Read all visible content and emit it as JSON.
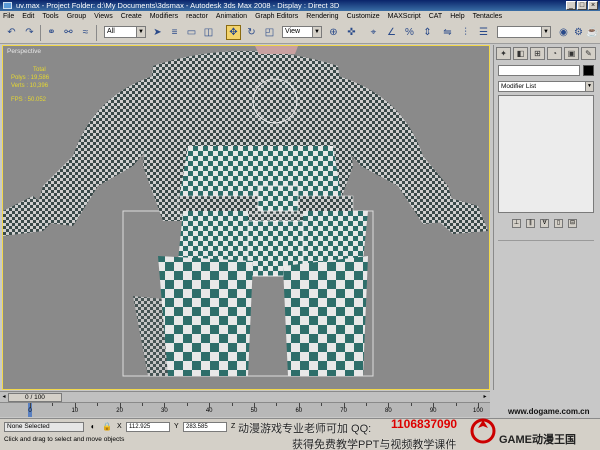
{
  "window": {
    "title": "uv.max    - Project Folder: d:\\My Documents\\3dsmax    - Autodesk 3ds Max 2008    - Display : Direct 3D",
    "controls": [
      "_",
      "□",
      "×"
    ]
  },
  "menu": [
    "File",
    "Edit",
    "Tools",
    "Group",
    "Views",
    "Create",
    "Modifiers",
    "reactor",
    "Animation",
    "Graph Editors",
    "Rendering",
    "Customize",
    "MAXScript",
    "CAT",
    "Help",
    "Tentacles"
  ],
  "toolbar": {
    "selection_filter": "All",
    "reference_coord": "View",
    "icons": [
      "undo-icon",
      "redo-icon",
      "link-icon",
      "unlink-icon",
      "bind-space-warp-icon",
      "select-object-icon",
      "select-by-name-icon",
      "select-region-icon",
      "window-crossing-icon",
      "select-move-icon",
      "select-rotate-icon",
      "select-scale-icon",
      "pivot-center-icon",
      "select-manipulate-icon",
      "snap-toggle-icon",
      "angle-snap-icon",
      "percent-snap-icon",
      "spinner-snap-icon",
      "mirror-icon",
      "align-icon",
      "layer-manager-icon",
      "curve-editor-icon",
      "schematic-view-icon",
      "material-editor-icon",
      "render-setup-icon",
      "quick-render-icon"
    ]
  },
  "viewport": {
    "label": "Perspective",
    "stats": {
      "heading": "Total",
      "polys": "Polys : 19,586",
      "verts": "Verts : 10,396",
      "fps": "FPS : 50.052"
    }
  },
  "command_panel": {
    "tabs": [
      "create-tab-icon",
      "modify-tab-icon",
      "hierarchy-tab-icon",
      "motion-tab-icon",
      "display-tab-icon",
      "utilities-tab-icon"
    ],
    "object_name": "",
    "modifier_list": "Modifier List"
  },
  "timeline": {
    "frame": "0 / 100",
    "ticks": [
      0,
      10,
      20,
      30,
      40,
      50,
      60,
      70,
      80,
      90,
      100
    ]
  },
  "statusbar": {
    "selection": "None Selected",
    "prompt": "Click and drag to select and move objects",
    "x_label": "X",
    "x_value": "112.925",
    "y_label": "Y",
    "y_value": "283.585",
    "z_label": "Z"
  },
  "watermark": {
    "line1": "动漫游戏专业老师可加 QQ:",
    "qq": "1106837090",
    "line2": "获得免费教学PPT与视频教学课件",
    "logo_text": "GAME动漫王国",
    "site": "www.dogame.com.cn"
  },
  "colors": {
    "title_bar": "#0a246a",
    "viewport_bg": "#8a8a8a",
    "viewport_border_active": "#f2d84b",
    "stats_text": "#e6d830",
    "checker_dark": "#2e6e6a",
    "checker_light": "#e8e8e8"
  }
}
